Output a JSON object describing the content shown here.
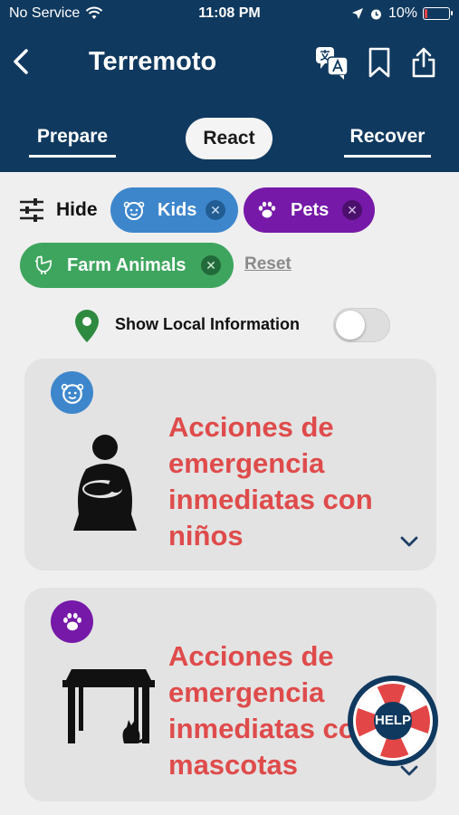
{
  "status_bar": {
    "carrier": "No Service",
    "time": "11:08 PM",
    "battery_percent": "10%",
    "battery_level": 0.1,
    "battery_color": "#e34646"
  },
  "nav": {
    "title": "Terremoto",
    "back_icon": "chevron-left-icon",
    "translate_icon": "translate-icon",
    "bookmark_icon": "bookmark-icon",
    "share_icon": "share-icon"
  },
  "tabs": [
    {
      "label": "Prepare",
      "selected": false
    },
    {
      "label": "React",
      "selected": true
    },
    {
      "label": "Recover",
      "selected": false
    }
  ],
  "filters": {
    "hide_label": "Hide",
    "reset_label": "Reset",
    "chips": [
      {
        "label": "Kids",
        "color": "#3d86cc",
        "icon": "kid-face-icon"
      },
      {
        "label": "Pets",
        "color": "#7619a8",
        "icon": "paw-icon"
      },
      {
        "label": "Farm Animals",
        "color": "#3ea55e",
        "icon": "chicken-icon"
      }
    ]
  },
  "local_info": {
    "label": "Show Local Information",
    "enabled": false
  },
  "cards": [
    {
      "title": "Acciones de emergencia inmediatas con niños",
      "category_color": "#3d86cc",
      "category_icon": "kid-face-icon",
      "illustration": "parent-holding-child-icon"
    },
    {
      "title": "Acciones de emergencia inmediatas con mascotas",
      "category_color": "#7619a8",
      "category_icon": "paw-icon",
      "illustration": "pet-under-table-icon"
    }
  ],
  "help_button": {
    "label": "HELP"
  },
  "colors": {
    "header_bg": "#10395f",
    "card_title": "#df4b4b",
    "page_bg": "#efefef"
  }
}
